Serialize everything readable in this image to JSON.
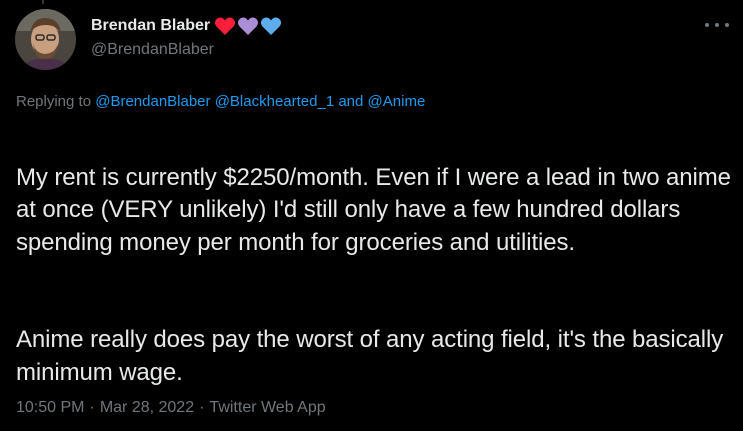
{
  "author": {
    "display_name": "Brendan Blaber",
    "handle": "@BrendanBlaber",
    "name_emoji": [
      "red-heart-icon",
      "purple-heart-icon",
      "blue-heart-icon"
    ],
    "heart_colors": [
      "#f91f3a",
      "#aa8ed6",
      "#5dadec"
    ]
  },
  "reply_context": {
    "prefix": "Replying to",
    "mention_1": "@BrendanBlaber",
    "mention_2": "@Blackhearted_1",
    "conjunction": "and",
    "mention_3": "@Anime"
  },
  "tweet": {
    "paragraph_1": "My rent is currently $2250/month. Even if I were a lead in two anime at once (VERY unlikely) I'd still only have a few hundred dollars spending money per month for groceries and utilities.",
    "paragraph_2": "Anime really does pay the worst of any acting field, it's the basically minimum wage."
  },
  "meta": {
    "time": "10:50 PM",
    "date": "Mar 28, 2022",
    "source": "Twitter Web App",
    "separator": "·"
  },
  "colors": {
    "background": "#000000",
    "text": "#e7e9ea",
    "secondary": "#71767b",
    "link": "#1d9bf0"
  }
}
